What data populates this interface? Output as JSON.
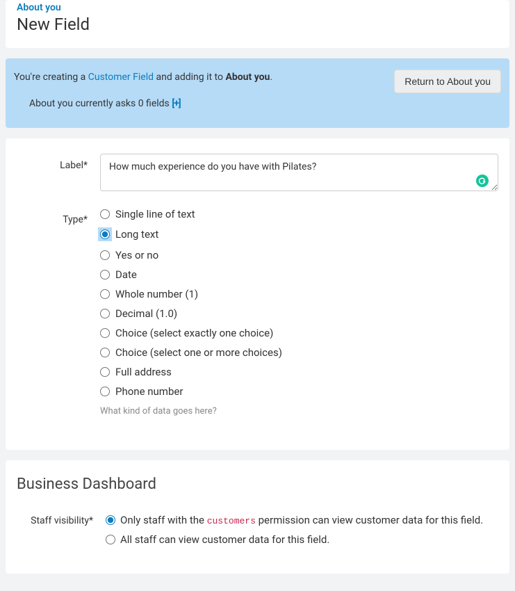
{
  "header": {
    "breadcrumb": "About you",
    "title": "New Field"
  },
  "banner": {
    "line1_prefix": "You're creating a ",
    "line1_link": "Customer Field",
    "line1_mid": " and adding it to ",
    "line1_strong": "About you",
    "line1_suffix": ".",
    "line2_prefix": "About you currently asks 0 fields ",
    "expand_label": "[+]",
    "return_button": "Return to About you"
  },
  "form": {
    "label_field": "Label*",
    "label_value": "How much experience do you have with Pilates?",
    "type_field": "Type*",
    "type_options": [
      "Single line of text",
      "Long text",
      "Yes or no",
      "Date",
      "Whole number (1)",
      "Decimal (1.0)",
      "Choice (select exactly one choice)",
      "Choice (select one or more choices)",
      "Full address",
      "Phone number"
    ],
    "type_selected_index": 1,
    "type_help": "What kind of data goes here?"
  },
  "dashboard": {
    "section_title": "Business Dashboard",
    "visibility_label": "Staff visibility*",
    "visibility_options": {
      "opt1_prefix": "Only staff with the ",
      "opt1_code": "customers",
      "opt1_suffix": " permission can view customer data for this field.",
      "opt2": "All staff can view customer data for this field."
    },
    "visibility_selected_index": 0
  },
  "icons": {
    "grammarly": "G"
  }
}
